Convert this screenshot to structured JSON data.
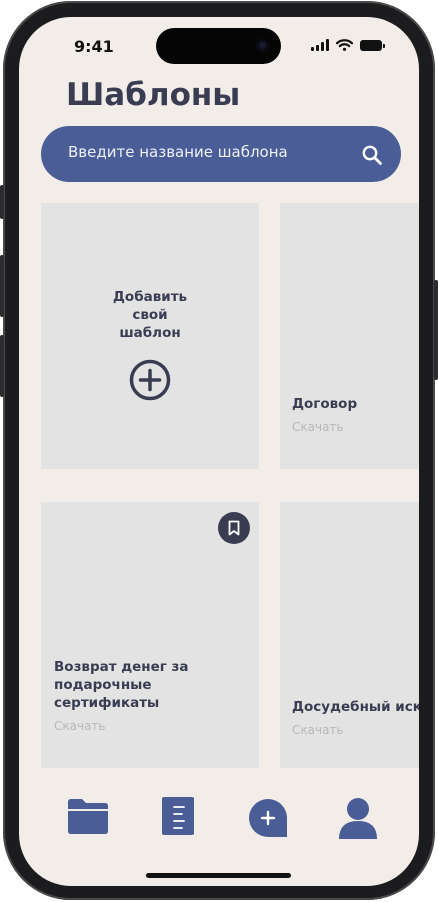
{
  "status_bar": {
    "time": "9:41"
  },
  "header": {
    "title": "Шаблоны"
  },
  "search": {
    "placeholder": "Введите название шаблона"
  },
  "cards": [
    {
      "title": "Добавить\nсвой\nшаблон",
      "type": "add"
    },
    {
      "title": "Договор",
      "link": "Скачать"
    },
    {
      "title": "Возврат денег за\nподарочные\nсертификаты",
      "link": "Скачать",
      "bookmarked": true
    },
    {
      "title": "Досудебный иск",
      "link": "Скачать"
    }
  ],
  "tab_bar": {
    "items": [
      {
        "icon": "folder-icon"
      },
      {
        "icon": "document-icon"
      },
      {
        "icon": "add-chat-icon"
      },
      {
        "icon": "profile-icon"
      }
    ]
  },
  "colors": {
    "accent": "#4b5d96",
    "dark": "#3a3d52",
    "background": "#f2ede8",
    "card": "#e3e3e3"
  }
}
